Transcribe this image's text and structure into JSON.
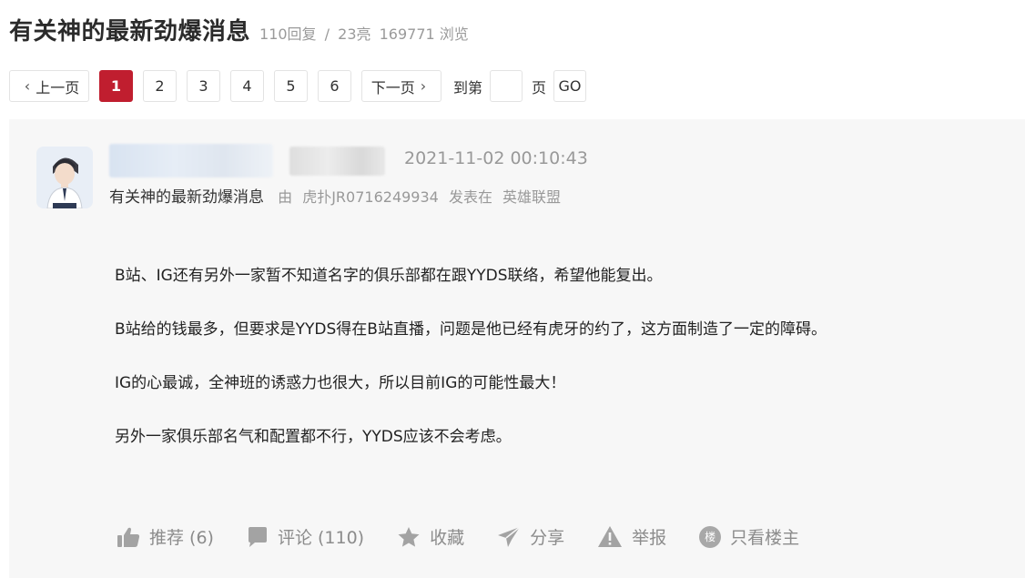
{
  "header": {
    "title": "有关神的最新劲爆消息",
    "replies": "110回复",
    "separator": "/",
    "likes": "23亮",
    "views": "169771 浏览"
  },
  "pager": {
    "prev": "上一页",
    "pages": [
      "1",
      "2",
      "3",
      "4",
      "5",
      "6"
    ],
    "current": "1",
    "next": "下一页",
    "goto_label": "到第",
    "page_label": "页",
    "go": "GO"
  },
  "post": {
    "time": "2021-11-02 00:10:43",
    "thread_title": "有关神的最新劲爆消息",
    "by": "由",
    "author": "虎扑JR0716249934",
    "posted_in": "发表在",
    "forum": "英雄联盟",
    "paragraphs": [
      "B站、IG还有另外一家暂不知道名字的俱乐部都在跟YYDS联络，希望他能复出。",
      "B站给的钱最多，但要求是YYDS得在B站直播，问题是他已经有虎牙的约了，这方面制造了一定的障碍。",
      "IG的心最诚，全神班的诱惑力也很大，所以目前IG的可能性最大！",
      "另外一家俱乐部名气和配置都不行，YYDS应该不会考虑。"
    ]
  },
  "actions": {
    "recommend": "推荐 (6)",
    "comment": "评论 (110)",
    "favorite": "收藏",
    "share": "分享",
    "report": "举报",
    "louzhu_badge": "楼",
    "only_op": "只看楼主"
  },
  "colors": {
    "accent": "#c01e2f",
    "post_bg": "#f7f7f7",
    "muted": "#999999"
  }
}
